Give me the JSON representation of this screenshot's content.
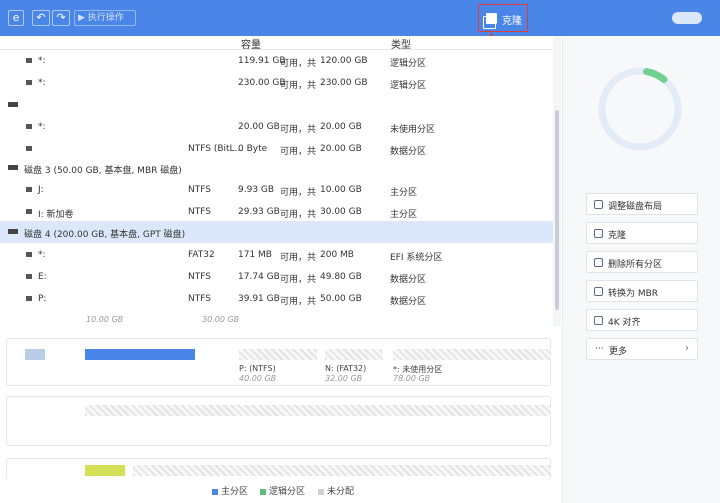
{
  "toolbar": {
    "logo_glyph": "e",
    "undo_glyph": "↶",
    "redo_glyph": "↷",
    "apply_label": "▶ 执行操作",
    "clone_label": "克隆"
  },
  "table": {
    "columns": {
      "capacity": "容量",
      "type": "类型"
    },
    "rows": [
      {
        "name": "*:",
        "fs": "",
        "used": "119.91 GB",
        "free_label": "可用，共",
        "total": "120.00 GB",
        "type": "逻辑分区"
      },
      {
        "name": "*:",
        "fs": "",
        "used": "230.00 GB",
        "free_label": "可用，共",
        "total": "230.00 GB",
        "type": "逻辑分区"
      },
      {
        "name": "",
        "fs": "",
        "used": "",
        "free_label": "",
        "total": "",
        "type": ""
      },
      {
        "name": "*:",
        "fs": "",
        "used": "20.00 GB",
        "free_label": "可用，共",
        "total": "20.00 GB",
        "type": "未使用分区"
      },
      {
        "name": "",
        "fs": "NTFS (BitL...",
        "used": "0 Byte",
        "free_label": "可用，共",
        "total": "20.00 GB",
        "type": "数据分区"
      }
    ],
    "disk3": {
      "label": "磁盘 3 (50.00 GB, 基本盘, MBR 磁盘)"
    },
    "disk3_rows": [
      {
        "name": "J:",
        "fs": "NTFS",
        "used": "9.93 GB",
        "free_label": "可用，共",
        "total": "10.00 GB",
        "type": "主分区"
      },
      {
        "name": "I: 新加卷",
        "fs": "NTFS",
        "used": "29.93 GB",
        "free_label": "可用，共",
        "total": "30.00 GB",
        "type": "主分区"
      }
    ],
    "disk4": {
      "label": "磁盘 4 (200.00 GB, 基本盘, GPT 磁盘)"
    },
    "disk4_rows": [
      {
        "name": "*:",
        "fs": "FAT32",
        "used": "171 MB",
        "free_label": "可用，共",
        "total": "200 MB",
        "type": "EFI 系统分区"
      },
      {
        "name": "E:",
        "fs": "NTFS",
        "used": "17.74 GB",
        "free_label": "可用，共",
        "total": "49.80 GB",
        "type": "数据分区"
      },
      {
        "name": "P:",
        "fs": "NTFS",
        "used": "39.91 GB",
        "free_label": "可用，共",
        "total": "50.00 GB",
        "type": "数据分区"
      }
    ]
  },
  "ruler": {
    "a": "10.00 GB",
    "b": "30.00 GB"
  },
  "diskmap": {
    "p_label": "P: (NTFS)",
    "p_size": "40.00 GB",
    "n_label": "N: (FAT32)",
    "n_size": "32.00 GB",
    "u_label": "*: 未使用分区",
    "u_size": "78.00 GB"
  },
  "legend": {
    "primary": "主分区",
    "logical": "逻辑分区",
    "unalloc": "未分配"
  },
  "colors": {
    "primary": "#4a86e8",
    "logical": "#5cc27b",
    "unalloc": "#d0d0d0",
    "accent": "#4a86e8",
    "highlight": "#e33b3b",
    "ring_progress": "#6fd08f"
  },
  "usage_ring": {
    "fraction": 0.08
  },
  "actions": [
    {
      "label": "调整磁盘布局",
      "icon": "layout-icon"
    },
    {
      "label": "克隆",
      "icon": "clone-icon"
    },
    {
      "label": "删除所有分区",
      "icon": "trash-icon"
    },
    {
      "label": "转换为 MBR",
      "icon": "convert-icon"
    },
    {
      "label": "4K 对齐",
      "icon": "align-icon"
    },
    {
      "label": "更多",
      "icon": "more-icon",
      "chevron": "›"
    }
  ]
}
